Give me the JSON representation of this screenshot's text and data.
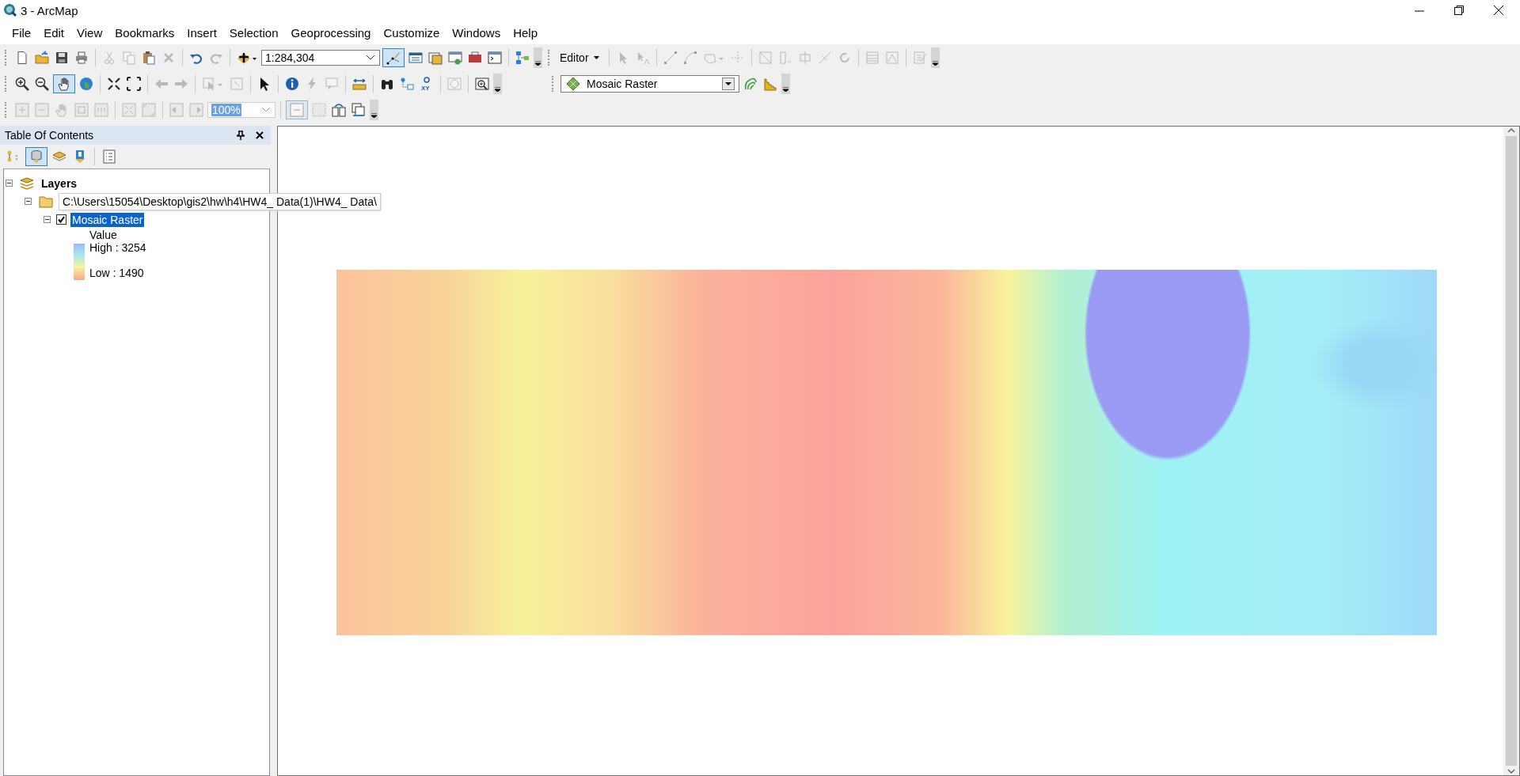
{
  "window": {
    "title": "3 - ArcMap"
  },
  "menu": [
    "File",
    "Edit",
    "View",
    "Bookmarks",
    "Insert",
    "Selection",
    "Geoprocessing",
    "Customize",
    "Windows",
    "Help"
  ],
  "standard_toolbar": {
    "scale": "1:284,304"
  },
  "tools_toolbar": {
    "go_to_xy": "XY"
  },
  "editor_toolbar": {
    "label": "Editor"
  },
  "layout_toolbar": {
    "zoom": "100%"
  },
  "image_analysis_toolbar": {
    "layer": "Mosaic Raster"
  },
  "table_of_contents": {
    "title": "Table Of Contents",
    "tree": [
      {
        "label": "Layers",
        "kind": "data-frame",
        "expanded": true,
        "children": [
          {
            "label": "C:\\Users\\15054\\Desktop\\gis2\\hw\\h4\\HW4_ Data(1)\\HW4_ Data\\",
            "kind": "folder",
            "expanded": true,
            "children": [
              {
                "label": "Mosaic Raster",
                "kind": "layer",
                "expanded": true,
                "checked": true,
                "selected": true,
                "legend": {
                  "field": "Value",
                  "high": "High : 3254",
                  "low": "Low : 1490"
                }
              }
            ]
          }
        ]
      }
    ]
  }
}
